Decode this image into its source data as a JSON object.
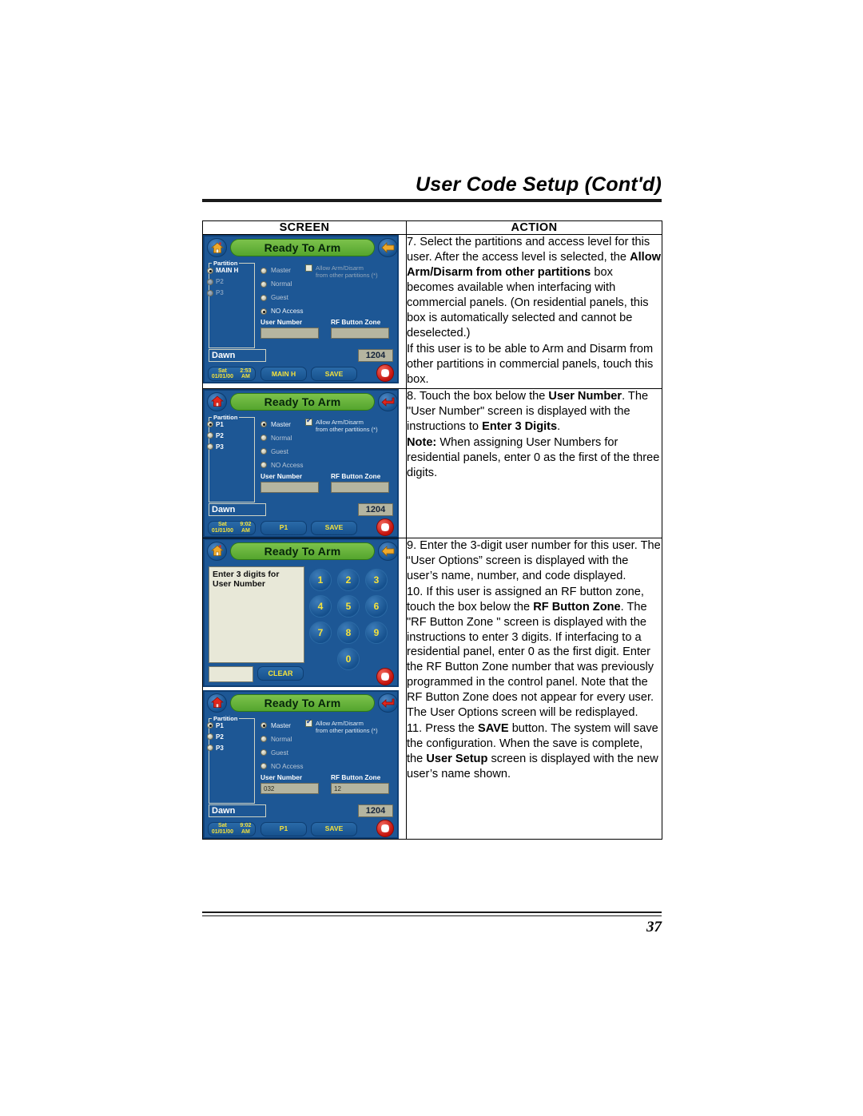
{
  "document": {
    "title": "User Code Setup (Cont'd)",
    "page_number": "37"
  },
  "table": {
    "headers": {
      "screen": "SCREEN",
      "action": "ACTION"
    }
  },
  "screens": [
    {
      "id": "user-options-no-access",
      "status": "Ready To Arm",
      "home_icon": "home-icon",
      "back_icon": "back-arrow-icon",
      "icon_color": "#f0a92b",
      "partition_legend": "Partition",
      "partitions": [
        {
          "label": "MAIN H",
          "selected": true,
          "enabled": true
        },
        {
          "label": "P2",
          "selected": false,
          "enabled": false
        },
        {
          "label": "P3",
          "selected": false,
          "enabled": false
        }
      ],
      "access_levels": [
        {
          "label": "Master",
          "selected": false
        },
        {
          "label": "Normal",
          "selected": false
        },
        {
          "label": "Guest",
          "selected": false
        },
        {
          "label": "NO Access",
          "selected": true
        }
      ],
      "allow": {
        "checked": false,
        "line1": "Allow Arm/Disarm",
        "line2": "from other partitions (*)"
      },
      "user_number": {
        "label": "User Number",
        "value": ""
      },
      "rf_button_zone": {
        "label": "RF Button Zone",
        "value": ""
      },
      "user_name": "Dawn",
      "user_code": "1204",
      "toolbar": {
        "clock_line1": "Sat 01/01/00",
        "clock_line2": "2:53 AM",
        "middle": "MAIN H",
        "save": "SAVE",
        "panic": "panic-icon"
      }
    },
    {
      "id": "user-options-master",
      "status": "Ready To Arm",
      "home_icon": "home-icon",
      "back_icon": "return-arrow-icon",
      "icon_color": "#e2261c",
      "partition_legend": "Partition",
      "partitions": [
        {
          "label": "P1",
          "selected": true,
          "enabled": true
        },
        {
          "label": "P2",
          "selected": false,
          "enabled": true
        },
        {
          "label": "P3",
          "selected": false,
          "enabled": true
        }
      ],
      "access_levels": [
        {
          "label": "Master",
          "selected": true
        },
        {
          "label": "Normal",
          "selected": false
        },
        {
          "label": "Guest",
          "selected": false
        },
        {
          "label": "NO Access",
          "selected": false
        }
      ],
      "allow": {
        "checked": true,
        "line1": "Allow Arm/Disarm",
        "line2": "from other partitions (*)"
      },
      "user_number": {
        "label": "User Number",
        "value": ""
      },
      "rf_button_zone": {
        "label": "RF Button Zone",
        "value": ""
      },
      "user_name": "Dawn",
      "user_code": "1204",
      "toolbar": {
        "clock_line1": "Sat 01/01/00",
        "clock_line2": "9:02 AM",
        "middle": "P1",
        "save": "SAVE",
        "panic": "panic-icon"
      }
    },
    {
      "id": "user-number-keypad",
      "status": "Ready To Arm",
      "home_icon": "home-icon",
      "back_icon": "back-arrow-icon",
      "icon_color": "#f0a92b",
      "prompt_line1": "Enter 3 digits for",
      "prompt_line2": "User Number",
      "entry_value": "",
      "clear_label": "CLEAR",
      "keys": [
        "1",
        "2",
        "3",
        "4",
        "5",
        "6",
        "7",
        "8",
        "9",
        "0"
      ],
      "panic": "panic-icon"
    },
    {
      "id": "user-options-filled",
      "status": "Ready To Arm",
      "home_icon": "home-icon",
      "back_icon": "return-arrow-icon",
      "icon_color": "#e2261c",
      "partition_legend": "Partition",
      "partitions": [
        {
          "label": "P1",
          "selected": true,
          "enabled": true
        },
        {
          "label": "P2",
          "selected": false,
          "enabled": true
        },
        {
          "label": "P3",
          "selected": false,
          "enabled": true
        }
      ],
      "access_levels": [
        {
          "label": "Master",
          "selected": true
        },
        {
          "label": "Normal",
          "selected": false
        },
        {
          "label": "Guest",
          "selected": false
        },
        {
          "label": "NO Access",
          "selected": false
        }
      ],
      "allow": {
        "checked": true,
        "line1": "Allow Arm/Disarm",
        "line2": "from other partitions (*)"
      },
      "user_number": {
        "label": "User Number",
        "value": "032"
      },
      "rf_button_zone": {
        "label": "RF Button Zone",
        "value": "12"
      },
      "user_name": "Dawn",
      "user_code": "1204",
      "toolbar": {
        "clock_line1": "Sat 01/01/00",
        "clock_line2": "9:02 AM",
        "middle": "P1",
        "save": "SAVE",
        "panic": "panic-icon"
      }
    }
  ],
  "actions": {
    "row1": {
      "p1_a": "7.  Select the partitions and access level for this user. After the access level is selected, the ",
      "p1_b": "Allow Arm/Disarm from other partitions",
      "p1_c": " box becomes available when interfacing with commercial panels. (On residential panels, this box is automatically selected and cannot be deselected.)",
      "p2": "If this user is to be able to Arm and Disarm from other partitions in commercial panels, touch this box."
    },
    "row2": {
      "p1_a": "8.  Touch the box below the ",
      "p1_b": "User Number",
      "p1_c": ".  The \"User Number\" screen is displayed with the instructions to ",
      "p1_d": "Enter 3 Digits",
      "p1_e": ".",
      "p2_a": "Note:",
      "p2_b": " When assigning User Numbers for residential panels, enter 0 as the first of the three digits."
    },
    "row3": {
      "p1": "9.  Enter the 3-digit user number for this user.  The “User Options” screen is displayed with the user’s name, number, and code displayed.",
      "p2_a": "10.  If this user is assigned an RF button zone, touch the box below the ",
      "p2_b": "RF Button Zone",
      "p2_c": ".  The \"RF Button Zone \" screen is displayed with the instructions to enter 3 digits. If interfacing to a residential panel, enter 0 as the first digit. Enter the RF Button Zone number that was previously programmed in the control panel. Note that the RF Button Zone does not appear for every user. The User Options screen will be redisplayed.",
      "p3_a": "11.  Press the ",
      "p3_b": "SAVE",
      "p3_c": " button.  The system will save the configuration.  When the save is complete, the ",
      "p3_d": "User Setup",
      "p3_e": " screen is displayed with the new user’s name shown."
    }
  }
}
